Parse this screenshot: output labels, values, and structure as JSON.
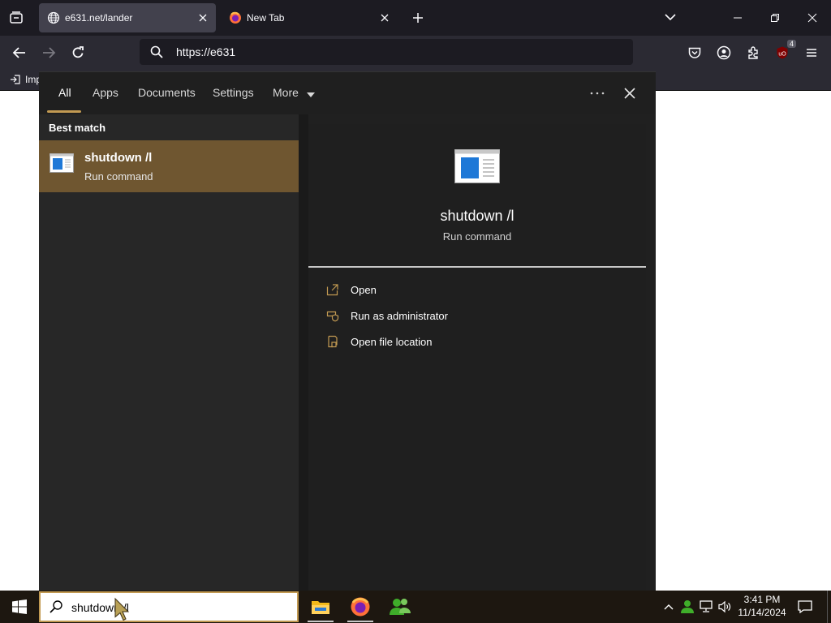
{
  "browser": {
    "tabs": [
      {
        "title": "e631.net/lander",
        "active": true,
        "icon": "globe-icon"
      },
      {
        "title": "New Tab",
        "active": false,
        "icon": "firefox-icon"
      }
    ],
    "url": "https://e631",
    "extension_badge": "4",
    "bookmarks": [
      {
        "label": "Imp",
        "icon": "import-icon"
      }
    ]
  },
  "search": {
    "tabs": [
      "All",
      "Apps",
      "Documents",
      "Settings",
      "More"
    ],
    "section_title": "Best match",
    "result": {
      "title": "shutdown /l",
      "subtitle": "Run command",
      "icon": "run-command-icon"
    },
    "detail": {
      "title": "shutdown /l",
      "subtitle": "Run command"
    },
    "actions": [
      {
        "label": "Open",
        "icon": "open-icon"
      },
      {
        "label": "Run as administrator",
        "icon": "shield-icon"
      },
      {
        "label": "Open file location",
        "icon": "file-location-icon"
      }
    ],
    "query": "shutdown /l"
  },
  "taskbar": {
    "apps": [
      "file-explorer-icon",
      "firefox-icon",
      "people-icon"
    ],
    "time": "3:41 PM",
    "date": "11/14/2024"
  },
  "colors": {
    "accent": "#c29a52",
    "selected_result": "#6f5630",
    "panel_bg": "#202020",
    "browser_bg": "#1c1b22"
  }
}
